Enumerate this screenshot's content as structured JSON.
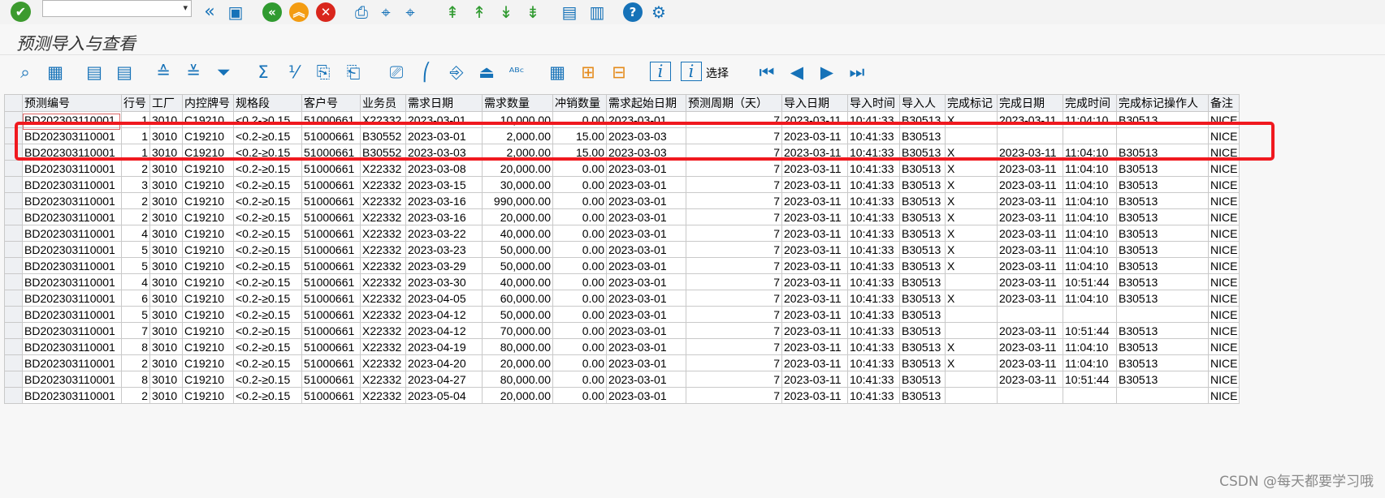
{
  "screen_title": "预测导入与查看",
  "toolbar": {
    "command_field_value": "",
    "icons": [
      "enter-icon",
      "back-double-icon",
      "save-icon",
      "back-icon",
      "exit-icon",
      "cancel-icon",
      "print-icon",
      "find-icon",
      "find-next-icon",
      "first-page-icon",
      "previous-page-icon",
      "next-page-icon",
      "last-page-icon",
      "create-session-icon",
      "shortcut-icon",
      "help-icon",
      "settings-icon"
    ]
  },
  "alv_toolbar": {
    "select_label": "选择",
    "icons": [
      "detail-icon",
      "table-icon",
      "select-all-icon",
      "deselect-all-icon",
      "sort-asc-icon",
      "sort-desc-icon",
      "filter-icon",
      "sum-icon",
      "subtotal-icon",
      "print-preview-icon",
      "export-icon",
      "word-icon",
      "spreadsheet-icon",
      "view-icon",
      "abc-icon",
      "layout-icon",
      "change-layout-icon",
      "save-layout-icon",
      "info-icon",
      "info2-icon",
      "first-icon",
      "prev-icon",
      "next-icon",
      "last-icon"
    ]
  },
  "table": {
    "columns": [
      "预测编号",
      "行号",
      "工厂",
      "内控牌号",
      "规格段",
      "客户号",
      "业务员",
      "需求日期",
      "需求数量",
      "冲销数量",
      "需求起始日期",
      "预测周期（天）",
      "导入日期",
      "导入时间",
      "导入人",
      "完成标记",
      "完成日期",
      "完成时间",
      "完成标记操作人",
      "备注"
    ],
    "rows": [
      [
        "BD202303110001",
        "1",
        "3010",
        "C19210",
        "<0.2-≥0.15",
        "51000661",
        "X22332",
        "2023-03-01",
        "10,000.00",
        "0.00",
        "2023-03-01",
        "7",
        "2023-03-11",
        "10:41:33",
        "B30513",
        "X",
        "2023-03-11",
        "11:04:10",
        "B30513",
        "NICE"
      ],
      [
        "BD202303110001",
        "1",
        "3010",
        "C19210",
        "<0.2-≥0.15",
        "51000661",
        "B30552",
        "2023-03-01",
        "2,000.00",
        "15.00",
        "2023-03-03",
        "7",
        "2023-03-11",
        "10:41:33",
        "B30513",
        "",
        "",
        "",
        "",
        "NICE"
      ],
      [
        "BD202303110001",
        "1",
        "3010",
        "C19210",
        "<0.2-≥0.15",
        "51000661",
        "B30552",
        "2023-03-03",
        "2,000.00",
        "15.00",
        "2023-03-03",
        "7",
        "2023-03-11",
        "10:41:33",
        "B30513",
        "X",
        "2023-03-11",
        "11:04:10",
        "B30513",
        "NICE"
      ],
      [
        "BD202303110001",
        "2",
        "3010",
        "C19210",
        "<0.2-≥0.15",
        "51000661",
        "X22332",
        "2023-03-08",
        "20,000.00",
        "0.00",
        "2023-03-01",
        "7",
        "2023-03-11",
        "10:41:33",
        "B30513",
        "X",
        "2023-03-11",
        "11:04:10",
        "B30513",
        "NICE"
      ],
      [
        "BD202303110001",
        "3",
        "3010",
        "C19210",
        "<0.2-≥0.15",
        "51000661",
        "X22332",
        "2023-03-15",
        "30,000.00",
        "0.00",
        "2023-03-01",
        "7",
        "2023-03-11",
        "10:41:33",
        "B30513",
        "X",
        "2023-03-11",
        "11:04:10",
        "B30513",
        "NICE"
      ],
      [
        "BD202303110001",
        "2",
        "3010",
        "C19210",
        "<0.2-≥0.15",
        "51000661",
        "X22332",
        "2023-03-16",
        "990,000.00",
        "0.00",
        "2023-03-01",
        "7",
        "2023-03-11",
        "10:41:33",
        "B30513",
        "X",
        "2023-03-11",
        "11:04:10",
        "B30513",
        "NICE"
      ],
      [
        "BD202303110001",
        "2",
        "3010",
        "C19210",
        "<0.2-≥0.15",
        "51000661",
        "X22332",
        "2023-03-16",
        "20,000.00",
        "0.00",
        "2023-03-01",
        "7",
        "2023-03-11",
        "10:41:33",
        "B30513",
        "X",
        "2023-03-11",
        "11:04:10",
        "B30513",
        "NICE"
      ],
      [
        "BD202303110001",
        "4",
        "3010",
        "C19210",
        "<0.2-≥0.15",
        "51000661",
        "X22332",
        "2023-03-22",
        "40,000.00",
        "0.00",
        "2023-03-01",
        "7",
        "2023-03-11",
        "10:41:33",
        "B30513",
        "X",
        "2023-03-11",
        "11:04:10",
        "B30513",
        "NICE"
      ],
      [
        "BD202303110001",
        "5",
        "3010",
        "C19210",
        "<0.2-≥0.15",
        "51000661",
        "X22332",
        "2023-03-23",
        "50,000.00",
        "0.00",
        "2023-03-01",
        "7",
        "2023-03-11",
        "10:41:33",
        "B30513",
        "X",
        "2023-03-11",
        "11:04:10",
        "B30513",
        "NICE"
      ],
      [
        "BD202303110001",
        "5",
        "3010",
        "C19210",
        "<0.2-≥0.15",
        "51000661",
        "X22332",
        "2023-03-29",
        "50,000.00",
        "0.00",
        "2023-03-01",
        "7",
        "2023-03-11",
        "10:41:33",
        "B30513",
        "X",
        "2023-03-11",
        "11:04:10",
        "B30513",
        "NICE"
      ],
      [
        "BD202303110001",
        "4",
        "3010",
        "C19210",
        "<0.2-≥0.15",
        "51000661",
        "X22332",
        "2023-03-30",
        "40,000.00",
        "0.00",
        "2023-03-01",
        "7",
        "2023-03-11",
        "10:41:33",
        "B30513",
        "",
        "2023-03-11",
        "10:51:44",
        "B30513",
        "NICE"
      ],
      [
        "BD202303110001",
        "6",
        "3010",
        "C19210",
        "<0.2-≥0.15",
        "51000661",
        "X22332",
        "2023-04-05",
        "60,000.00",
        "0.00",
        "2023-03-01",
        "7",
        "2023-03-11",
        "10:41:33",
        "B30513",
        "X",
        "2023-03-11",
        "11:04:10",
        "B30513",
        "NICE"
      ],
      [
        "BD202303110001",
        "5",
        "3010",
        "C19210",
        "<0.2-≥0.15",
        "51000661",
        "X22332",
        "2023-04-12",
        "50,000.00",
        "0.00",
        "2023-03-01",
        "7",
        "2023-03-11",
        "10:41:33",
        "B30513",
        "",
        "",
        "",
        "",
        "NICE"
      ],
      [
        "BD202303110001",
        "7",
        "3010",
        "C19210",
        "<0.2-≥0.15",
        "51000661",
        "X22332",
        "2023-04-12",
        "70,000.00",
        "0.00",
        "2023-03-01",
        "7",
        "2023-03-11",
        "10:41:33",
        "B30513",
        "",
        "2023-03-11",
        "10:51:44",
        "B30513",
        "NICE"
      ],
      [
        "BD202303110001",
        "8",
        "3010",
        "C19210",
        "<0.2-≥0.15",
        "51000661",
        "X22332",
        "2023-04-19",
        "80,000.00",
        "0.00",
        "2023-03-01",
        "7",
        "2023-03-11",
        "10:41:33",
        "B30513",
        "X",
        "2023-03-11",
        "11:04:10",
        "B30513",
        "NICE"
      ],
      [
        "BD202303110001",
        "2",
        "3010",
        "C19210",
        "<0.2-≥0.15",
        "51000661",
        "X22332",
        "2023-04-20",
        "20,000.00",
        "0.00",
        "2023-03-01",
        "7",
        "2023-03-11",
        "10:41:33",
        "B30513",
        "X",
        "2023-03-11",
        "11:04:10",
        "B30513",
        "NICE"
      ],
      [
        "BD202303110001",
        "8",
        "3010",
        "C19210",
        "<0.2-≥0.15",
        "51000661",
        "X22332",
        "2023-04-27",
        "80,000.00",
        "0.00",
        "2023-03-01",
        "7",
        "2023-03-11",
        "10:41:33",
        "B30513",
        "",
        "2023-03-11",
        "10:51:44",
        "B30513",
        "NICE"
      ],
      [
        "BD202303110001",
        "2",
        "3010",
        "C19210",
        "<0.2-≥0.15",
        "51000661",
        "X22332",
        "2023-05-04",
        "20,000.00",
        "0.00",
        "2023-03-01",
        "7",
        "2023-03-11",
        "10:41:33",
        "B30513",
        "",
        "",
        "",
        "",
        "NICE"
      ]
    ]
  },
  "watermark": "CSDN @每天都要学习哦",
  "colors": {
    "highlight_border": "#f0191f",
    "accent": "#1672b8",
    "ok_green": "#3c9a2e"
  }
}
